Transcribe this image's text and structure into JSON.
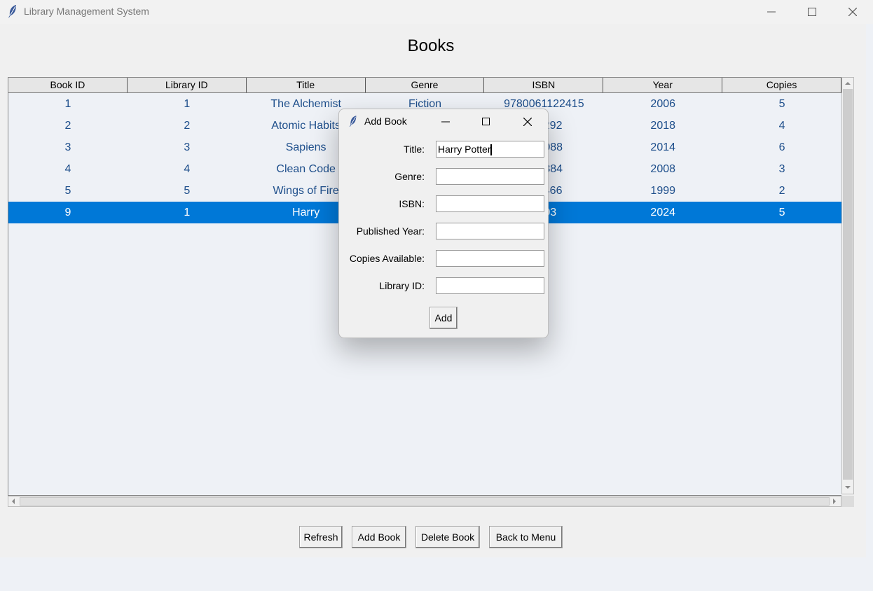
{
  "window": {
    "title": "Library Management System"
  },
  "heading": "Books",
  "table": {
    "columns": [
      "Book ID",
      "Library ID",
      "Title",
      "Genre",
      "ISBN",
      "Year",
      "Copies"
    ],
    "rows": [
      [
        "1",
        "1",
        "The Alchemist",
        "Fiction",
        "9780061122415",
        "2006",
        "5"
      ],
      [
        "2",
        "2",
        "Atomic Habits",
        "",
        "211292",
        "2018",
        "4"
      ],
      [
        "3",
        "3",
        "Sapiens",
        "",
        "590088",
        "2014",
        "6"
      ],
      [
        "4",
        "4",
        "Clean Code",
        "",
        "350884",
        "2008",
        "3"
      ],
      [
        "5",
        "5",
        "Wings of Fire",
        "",
        "711466",
        "1999",
        "2"
      ],
      [
        "9",
        "1",
        "Harry",
        "",
        "3903",
        "2024",
        "5"
      ]
    ],
    "selected_row_index": 5
  },
  "buttons": {
    "refresh": "Refresh",
    "add_book": "Add Book",
    "delete_book": "Delete Book",
    "back_to_menu": "Back to Menu"
  },
  "dialog": {
    "title": "Add Book",
    "fields": {
      "title_label": "Title:",
      "title_value": "Harry Potter",
      "genre_label": "Genre:",
      "genre_value": "",
      "isbn_label": "ISBN:",
      "isbn_value": "",
      "year_label": "Published Year:",
      "year_value": "",
      "copies_label": "Copies Available:",
      "copies_value": "",
      "library_label": "Library ID:",
      "library_value": ""
    },
    "add_label": "Add"
  },
  "colors": {
    "selection": "#0078d7",
    "cell_text": "#1d4e8b"
  },
  "icons": [
    "feather-icon",
    "minimize-icon",
    "maximize-icon",
    "close-icon"
  ]
}
